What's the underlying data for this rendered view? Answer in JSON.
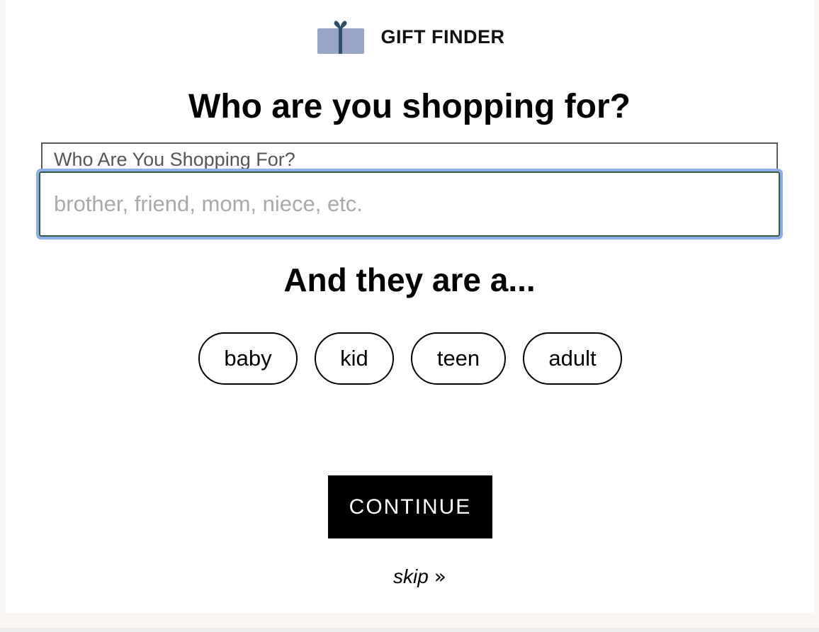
{
  "header": {
    "brand_title": "GIFT FINDER",
    "icon": "gift-box-icon",
    "icon_colors": {
      "box": "#98a4c8",
      "ribbon": "#2c4f6a"
    }
  },
  "main": {
    "title": "Who are you shopping for?",
    "recipient_field": {
      "label": "Who Are You Shopping For?",
      "placeholder": "brother, friend, mom, niece, etc.",
      "value": ""
    },
    "subtitle": "And they are a...",
    "age_options": [
      "baby",
      "kid",
      "teen",
      "adult"
    ],
    "continue_label": "CONTINUE",
    "skip_label": "skip",
    "skip_icon_glyph": "»"
  },
  "colors": {
    "focus_ring": "#8eaeea",
    "button_bg": "#000000",
    "page_bg": "#f8f5f2"
  }
}
